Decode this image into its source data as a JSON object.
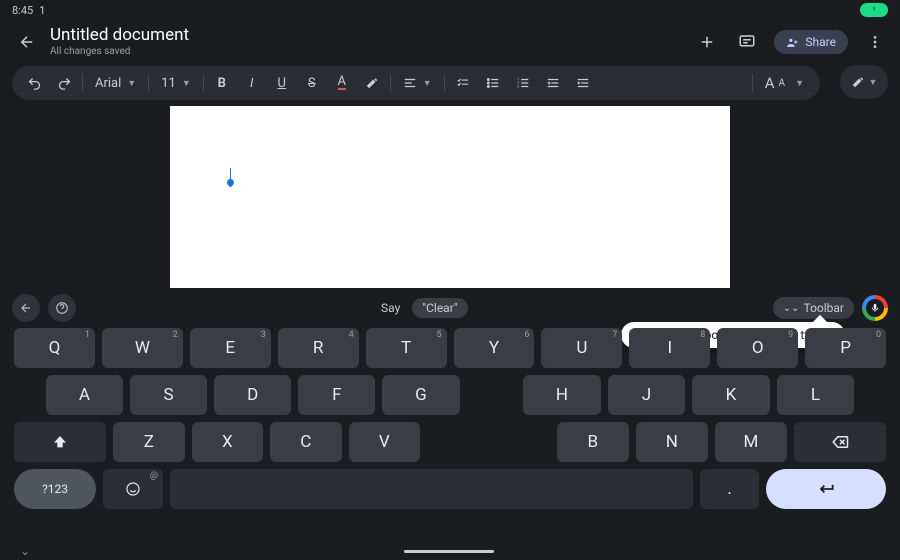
{
  "statusbar": {
    "time": "8:45",
    "num": "1"
  },
  "header": {
    "title": "Untitled document",
    "save_status": "All changes saved",
    "share_label": "Share"
  },
  "toolbar": {
    "font_name": "Arial",
    "font_size": "11"
  },
  "kb_top": {
    "say_label": "Say",
    "clear_chip": "\"Clear\"",
    "toolbar_chip": "Toolbar"
  },
  "tooltip": {
    "text": "Hide your keyboard while voice typing"
  },
  "keyboard": {
    "row1": [
      {
        "k": "Q",
        "s": "1"
      },
      {
        "k": "W",
        "s": "2"
      },
      {
        "k": "E",
        "s": "3"
      },
      {
        "k": "R",
        "s": "4"
      },
      {
        "k": "T",
        "s": "5"
      },
      {
        "k": "Y",
        "s": "6"
      },
      {
        "k": "U",
        "s": "7"
      },
      {
        "k": "I",
        "s": "8"
      },
      {
        "k": "O",
        "s": "9"
      },
      {
        "k": "P",
        "s": "0"
      }
    ],
    "row2_left": [
      {
        "k": "A"
      },
      {
        "k": "S"
      },
      {
        "k": "D"
      },
      {
        "k": "F"
      },
      {
        "k": "G"
      }
    ],
    "row2_right": [
      {
        "k": "H"
      },
      {
        "k": "J"
      },
      {
        "k": "K"
      },
      {
        "k": "L"
      }
    ],
    "row3_left": [
      {
        "k": "Z"
      },
      {
        "k": "X"
      },
      {
        "k": "C"
      },
      {
        "k": "V"
      }
    ],
    "row3_right": [
      {
        "k": "B"
      },
      {
        "k": "N"
      },
      {
        "k": "M"
      }
    ],
    "sym_label": "?123",
    "period": "."
  }
}
